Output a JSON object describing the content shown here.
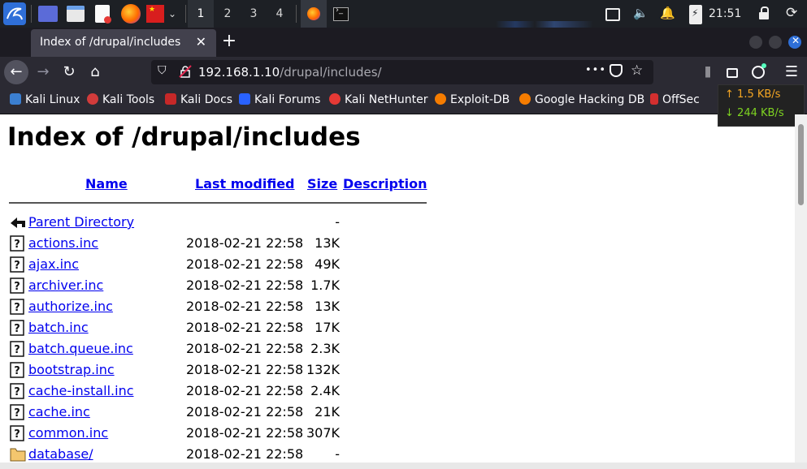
{
  "taskbar": {
    "workspaces": [
      "1",
      "2",
      "3",
      "4"
    ],
    "active_workspace": "1",
    "clock": "21:51",
    "icons": [
      "kali-menu-icon",
      "workspace-switcher-icon",
      "file-manager-icon",
      "text-editor-icon",
      "firefox-icon",
      "flag-icon",
      "chevron-down-icon",
      "firefox-window-icon",
      "terminal-icon",
      "display-icon",
      "volume-icon",
      "notification-bell-icon",
      "battery-icon",
      "lock-icon",
      "power-icon"
    ]
  },
  "browser": {
    "tab_title": "Index of /drupal/includes",
    "tab_close": "✕",
    "new_tab": "+",
    "url_host": "192.168.1.10",
    "url_path": "/drupal/includes/",
    "url_more": "•••"
  },
  "bookmarks": [
    {
      "label": "Kali Linux",
      "color": "#3b7fd1"
    },
    {
      "label": "Kali Tools",
      "color": "#d13b3b"
    },
    {
      "label": "Kali Docs",
      "color": "#c62828"
    },
    {
      "label": "Kali Forums",
      "color": "#2962ff"
    },
    {
      "label": "Kali NetHunter",
      "color": "#e53935"
    },
    {
      "label": "Exploit-DB",
      "color": "#f57c00"
    },
    {
      "label": "Google Hacking DB",
      "color": "#f57c00"
    },
    {
      "label": "OffSec",
      "color": "#d32f2f"
    }
  ],
  "netspeed": {
    "up": "1.5 KB/s",
    "down": "244 KB/s",
    "up_color": "#f5a623",
    "down_color": "#7ed321"
  },
  "listing": {
    "title": "Index of /drupal/includes",
    "headers": {
      "name": "Name",
      "last_modified": "Last modified",
      "size": "Size",
      "description": "Description"
    },
    "rows": [
      {
        "name": "Parent Directory",
        "date": "",
        "size": "-",
        "icon": "back-arrow-icon"
      },
      {
        "name": "actions.inc",
        "date": "2018-02-21 22:58",
        "size": "13K",
        "icon": "unknown-file-icon"
      },
      {
        "name": "ajax.inc",
        "date": "2018-02-21 22:58",
        "size": "49K",
        "icon": "unknown-file-icon"
      },
      {
        "name": "archiver.inc",
        "date": "2018-02-21 22:58",
        "size": "1.7K",
        "icon": "unknown-file-icon"
      },
      {
        "name": "authorize.inc",
        "date": "2018-02-21 22:58",
        "size": "13K",
        "icon": "unknown-file-icon"
      },
      {
        "name": "batch.inc",
        "date": "2018-02-21 22:58",
        "size": "17K",
        "icon": "unknown-file-icon"
      },
      {
        "name": "batch.queue.inc",
        "date": "2018-02-21 22:58",
        "size": "2.3K",
        "icon": "unknown-file-icon"
      },
      {
        "name": "bootstrap.inc",
        "date": "2018-02-21 22:58",
        "size": "132K",
        "icon": "unknown-file-icon"
      },
      {
        "name": "cache-install.inc",
        "date": "2018-02-21 22:58",
        "size": "2.4K",
        "icon": "unknown-file-icon"
      },
      {
        "name": "cache.inc",
        "date": "2018-02-21 22:58",
        "size": "21K",
        "icon": "unknown-file-icon"
      },
      {
        "name": "common.inc",
        "date": "2018-02-21 22:58",
        "size": "307K",
        "icon": "unknown-file-icon"
      },
      {
        "name": "database/",
        "date": "2018-02-21 22:58",
        "size": "-",
        "icon": "folder-icon"
      }
    ]
  }
}
